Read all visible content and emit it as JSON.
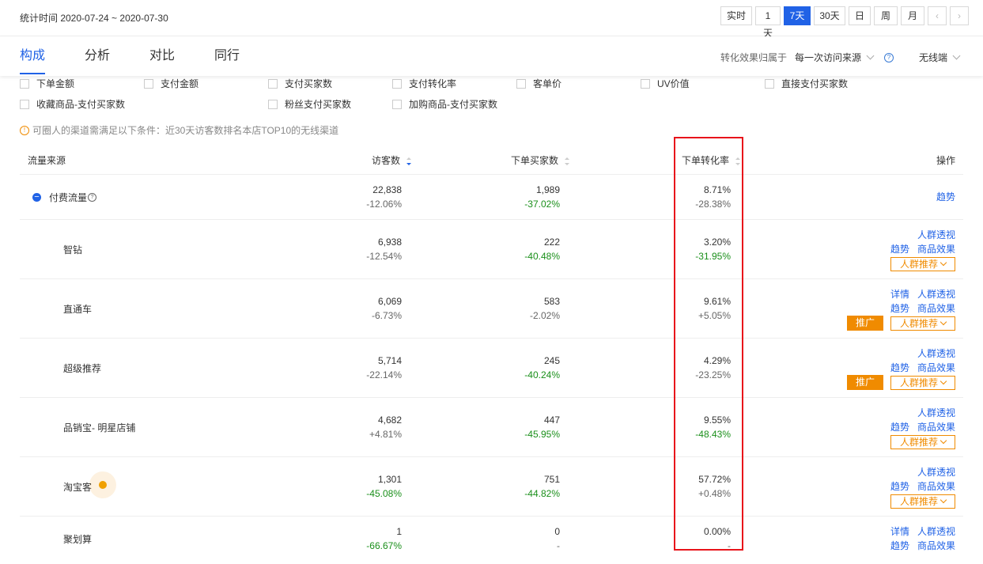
{
  "header": {
    "stat_time": "统计时间 2020-07-24 ~ 2020-07-30",
    "periods": [
      "实时",
      "1天",
      "7天",
      "30天",
      "日",
      "周",
      "月"
    ],
    "active_period": "7天"
  },
  "nav": {
    "tabs": [
      "构成",
      "分析",
      "对比",
      "同行"
    ],
    "active_tab": "构成",
    "attribution_label": "转化效果归属于",
    "attribution_value": "每一次访问来源",
    "device_value": "无线端"
  },
  "metrics": {
    "row1": [
      "下单金额",
      "支付金额",
      "支付买家数",
      "支付转化率",
      "客单价",
      "UV价值",
      "直接支付买家数"
    ],
    "row2": [
      "收藏商品-支付买家数",
      "粉丝支付买家数",
      "加购商品-支付买家数"
    ]
  },
  "notice": "可圈人的渠道需满足以下条件：近30天访客数排名本店TOP10的无线渠道",
  "table": {
    "headers": {
      "source": "流量来源",
      "visitors": "访客数",
      "order_buyers": "下单买家数",
      "order_rate": "下单转化率",
      "ops": "操作"
    },
    "parent": {
      "name": "付费流量",
      "visitors": "22,838",
      "visitors_change": "-12.06%",
      "buyers": "1,989",
      "buyers_change": "-37.02%",
      "rate": "8.71%",
      "rate_change": "-28.38%",
      "op": "趋势"
    },
    "rows": [
      {
        "name": "智钻",
        "visitors": "6,938",
        "visitors_change": "-12.54%",
        "buyers": "222",
        "buyers_change": "-40.48%",
        "rate": "3.20%",
        "rate_change": "-31.95%"
      },
      {
        "name": "直通车",
        "visitors": "6,069",
        "visitors_change": "-6.73%",
        "buyers": "583",
        "buyers_change": "-2.02%",
        "rate": "9.61%",
        "rate_change": "+5.05%"
      },
      {
        "name": "超级推荐",
        "visitors": "5,714",
        "visitors_change": "-22.14%",
        "buyers": "245",
        "buyers_change": "-40.24%",
        "rate": "4.29%",
        "rate_change": "-23.25%"
      },
      {
        "name": "品销宝- 明星店铺",
        "visitors": "4,682",
        "visitors_change": "+4.81%",
        "buyers": "447",
        "buyers_change": "-45.95%",
        "rate": "9.55%",
        "rate_change": "-48.43%"
      },
      {
        "name": "淘宝客",
        "visitors": "1,301",
        "visitors_change": "-45.08%",
        "buyers": "751",
        "buyers_change": "-44.82%",
        "rate": "57.72%",
        "rate_change": "+0.48%"
      },
      {
        "name": "聚划算",
        "visitors": "1",
        "visitors_change": "-66.67%",
        "buyers": "0",
        "buyers_change": "-",
        "rate": "0.00%",
        "rate_change": "-"
      }
    ],
    "ops": {
      "detail": "详情",
      "crowd_view": "人群透视",
      "trend": "趋势",
      "product_effect": "商品效果",
      "crowd_recommend": "人群推荐",
      "promote": "推广"
    }
  },
  "colors": {
    "accent": "#2062e6",
    "negative": "#1a8f1a",
    "orange": "#f08b00",
    "highlight": "#e8141b"
  }
}
